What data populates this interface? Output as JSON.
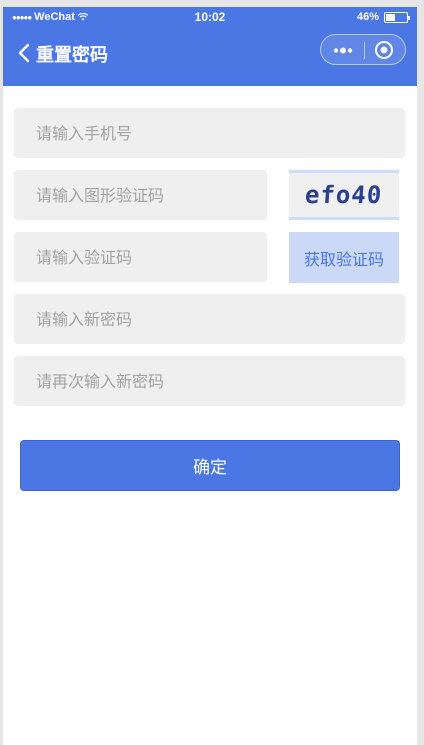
{
  "status_bar": {
    "carrier": "WeChat",
    "signal_dots": "●●●●●",
    "time": "10:02",
    "battery_text": "46%",
    "battery_level": 0.46
  },
  "nav": {
    "title": "重置密码",
    "back_icon": "chevron-left-icon",
    "capsule_more_icon": "more-dots-icon",
    "capsule_close_icon": "close-circle-icon"
  },
  "form": {
    "phone_placeholder": "请输入手机号",
    "captcha_placeholder": "请输入图形验证码",
    "captcha_image_text": "efo40",
    "sms_code_placeholder": "请输入验证码",
    "get_code_label": "获取验证码",
    "new_password_placeholder": "请输入新密码",
    "confirm_password_placeholder": "请再次输入新密码",
    "submit_label": "确定"
  },
  "colors": {
    "primary": "#4a77e3",
    "field_bg": "#efefef",
    "placeholder": "#a3a3a3",
    "sms_button_bg": "#cbd9f7"
  }
}
